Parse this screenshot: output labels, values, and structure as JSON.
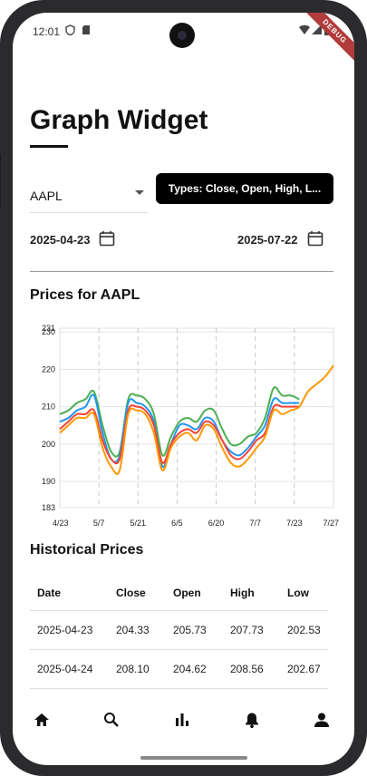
{
  "status_bar": {
    "time": "12:01",
    "shield_icon": "shield-icon",
    "sd_icon": "sd-card-icon",
    "wifi_icon": "wifi-icon",
    "signal_icon": "signal-icon",
    "battery_icon": "battery-icon"
  },
  "debug_banner": "DEBUG",
  "page": {
    "title": "Graph Widget"
  },
  "controls": {
    "symbol": "AAPL",
    "types_button": "Types: Close, Open, High, L...",
    "start_date": "2025-04-23",
    "end_date": "2025-07-22"
  },
  "chart_title": "Prices for AAPL",
  "chart_data": {
    "type": "line",
    "ylim": [
      183,
      231
    ],
    "y_ticks": [
      183,
      190,
      200,
      210,
      220,
      230,
      231
    ],
    "x_ticks": [
      "4/23",
      "5/7",
      "5/21",
      "6/5",
      "6/20",
      "7/7",
      "7/23",
      "7/27"
    ],
    "grid": true,
    "series": [
      {
        "color": "#4CAF50",
        "values": [
          208,
          209,
          211,
          212,
          214,
          205,
          198,
          198,
          212,
          213,
          212,
          208,
          197,
          202,
          206,
          207,
          206,
          209,
          209,
          204,
          200,
          200,
          202,
          203,
          207,
          215,
          213,
          213,
          212
        ]
      },
      {
        "color": "#2196F3",
        "values": [
          206,
          207,
          209,
          210,
          213,
          203,
          196,
          197,
          211,
          211,
          210,
          206,
          194,
          200,
          205,
          205,
          204,
          207,
          206,
          201,
          198,
          197,
          199,
          202,
          205,
          212,
          211,
          211,
          211
        ]
      },
      {
        "color": "#F44336",
        "values": [
          204,
          206,
          208,
          208,
          209,
          201,
          196,
          196,
          209,
          210,
          209,
          205,
          195,
          200,
          203,
          204,
          203,
          206,
          205,
          201,
          197,
          196,
          198,
          201,
          203,
          210,
          210,
          210,
          210
        ]
      },
      {
        "color": "#FF9800",
        "values": [
          203,
          205,
          207,
          207,
          208,
          199,
          194,
          193,
          208,
          209,
          208,
          203,
          193,
          199,
          202,
          203,
          201,
          205,
          204,
          199,
          195,
          194,
          196,
          199,
          202,
          209,
          208,
          209,
          210,
          214,
          216,
          218,
          221
        ]
      }
    ]
  },
  "history": {
    "title": "Historical Prices",
    "columns": [
      "Date",
      "Close",
      "Open",
      "High",
      "Low"
    ],
    "rows": [
      [
        "2025-04-23",
        "204.33",
        "205.73",
        "207.73",
        "202.53"
      ],
      [
        "2025-04-24",
        "208.10",
        "204.62",
        "208.56",
        "202.67"
      ]
    ]
  },
  "bottom_nav": {
    "icons": [
      "home-icon",
      "search-icon",
      "bar-chart-icon",
      "bell-icon",
      "person-icon"
    ]
  },
  "colors": {
    "accent": "#000000",
    "green": "#4CAF50",
    "blue": "#2196F3",
    "red": "#F44336",
    "orange": "#FF9800"
  }
}
